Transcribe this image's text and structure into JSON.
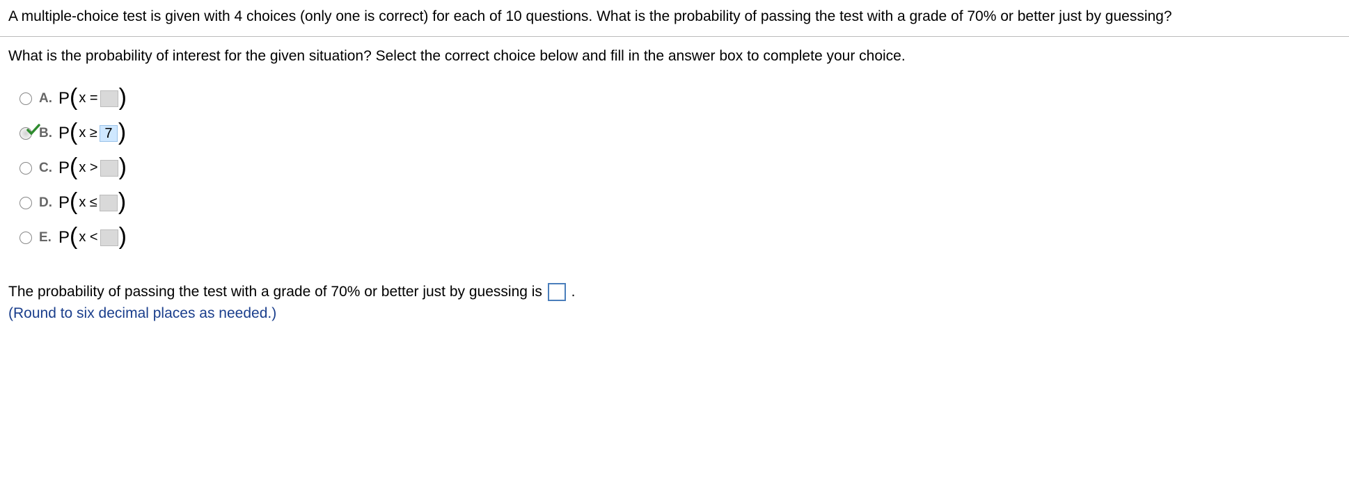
{
  "header": {
    "question_text": "A multiple-choice test is given with 4 choices (only one is correct) for each of 10 questions. What is the probability of passing the test with a grade of 70% or better just by guessing?"
  },
  "sub_question": {
    "text": "What is the probability of interest for the given situation? Select the correct choice below and fill in the answer box to complete your choice."
  },
  "choices": {
    "a": {
      "letter": "A.",
      "prefix": "P",
      "inner_left": "x =",
      "value": "",
      "selected": false
    },
    "b": {
      "letter": "B.",
      "prefix": "P",
      "inner_left": "x ≥",
      "value": "7",
      "selected": true
    },
    "c": {
      "letter": "C.",
      "prefix": "P",
      "inner_left": "x >",
      "value": "",
      "selected": false
    },
    "d": {
      "letter": "D.",
      "prefix": "P",
      "inner_left": "x ≤",
      "value": "",
      "selected": false
    },
    "e": {
      "letter": "E.",
      "prefix": "P",
      "inner_left": "x <",
      "value": "",
      "selected": false
    }
  },
  "final": {
    "text_before": "The probability of passing the test with a grade of 70% or better just by guessing is ",
    "text_after": ".",
    "answer": "",
    "note": "(Round to six decimal places as needed.)"
  }
}
